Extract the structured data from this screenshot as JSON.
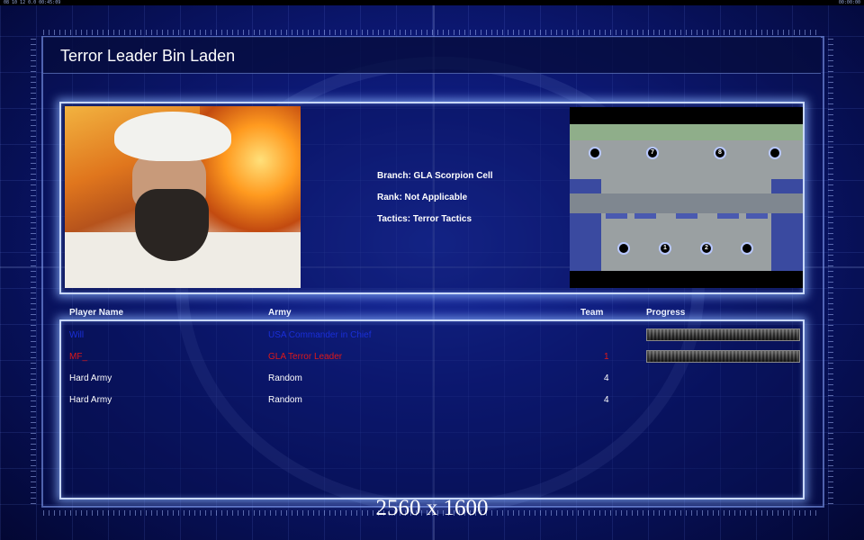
{
  "screen": {
    "title": "Terror Leader Bin Laden",
    "top_left_readout": "08 10 12 0.0 00:45:09",
    "top_right_readout": "00:00:00",
    "watermark": "2560 x 1600"
  },
  "general": {
    "portrait_icon": "portrait-image",
    "branch": "Branch: GLA Scorpion Cell",
    "rank": "Rank: Not Applicable",
    "tactics": "Tactics: Terror Tactics"
  },
  "map": {
    "spawn_labels": [
      "7",
      "8",
      "1",
      "2"
    ]
  },
  "table": {
    "headers": {
      "player_name": "Player Name",
      "army": "Army",
      "team": "Team",
      "progress": "Progress"
    },
    "rows": [
      {
        "name": "Will",
        "army": "USA Commander in Chief",
        "team": "",
        "color": "#1a2fd8",
        "progress": 0.0
      },
      {
        "name": "MF_",
        "army": "GLA Terror Leader",
        "team": "1",
        "color": "#e01818",
        "progress": 0.0
      },
      {
        "name": "Hard Army",
        "army": "Random",
        "team": "4",
        "color": "#ffffff"
      },
      {
        "name": "Hard Army",
        "army": "Random",
        "team": "4",
        "color": "#ffffff"
      }
    ]
  }
}
